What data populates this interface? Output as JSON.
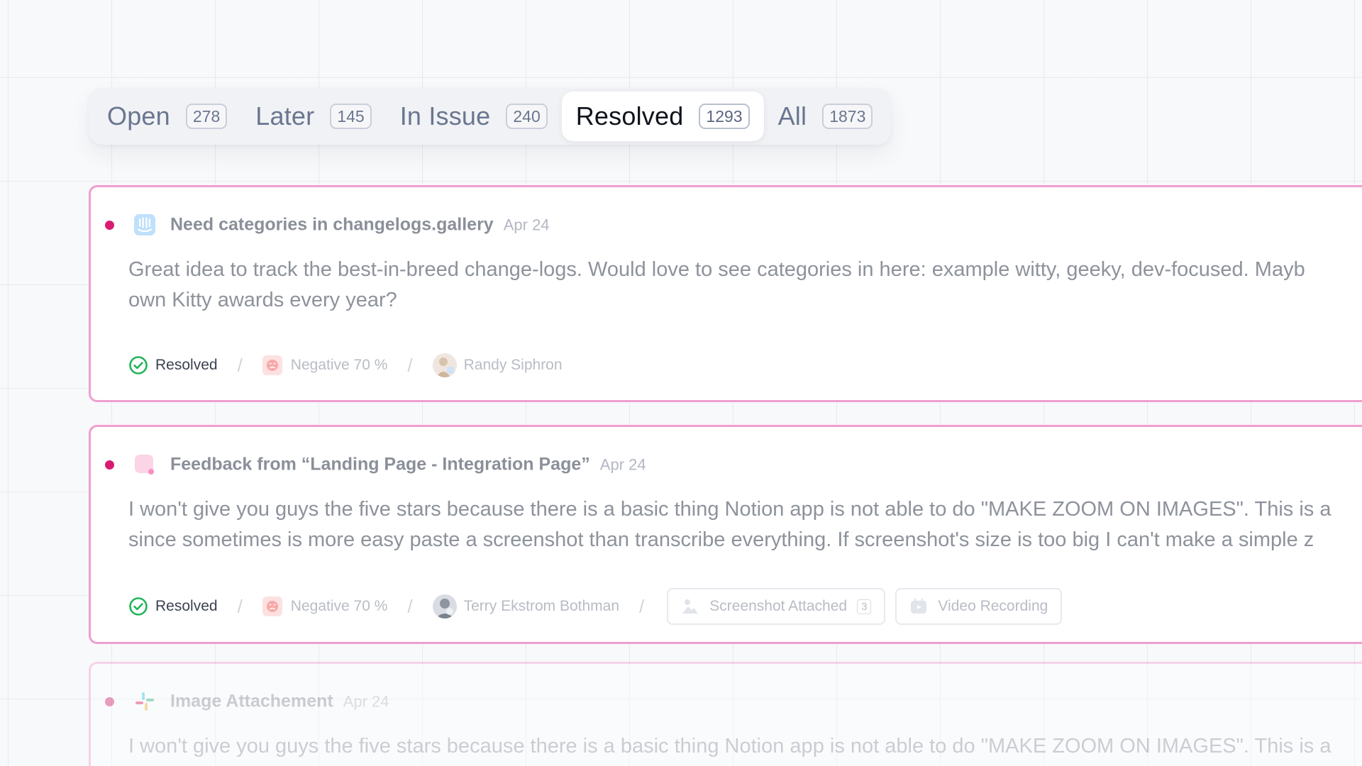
{
  "tabs": [
    {
      "label": "Open",
      "count": "278"
    },
    {
      "label": "Later",
      "count": "145"
    },
    {
      "label": "In Issue",
      "count": "240"
    },
    {
      "label": "Resolved",
      "count": "1293"
    },
    {
      "label": "All",
      "count": "1873"
    }
  ],
  "active_tab": "Resolved",
  "colors": {
    "accent_dot": "#d81b71",
    "card_border": "#ef9fd0",
    "resolved_green": "#22b45a"
  },
  "cards": [
    {
      "source_icon": "intercom-icon",
      "title": "Need categories in changelogs.gallery",
      "date": "Apr 24",
      "body_line1": "Great idea to track the best-in-breed change-logs. Would love to see categories in here: example witty, geeky, dev-focused. Mayb",
      "body_line2": "own Kitty awards every year?",
      "status": "Resolved",
      "sentiment": "Negative 70 %",
      "author": "Randy Siphron"
    },
    {
      "source_icon": "feedback-widget-icon",
      "title": "Feedback from “Landing Page - Integration Page”",
      "date": "Apr 24",
      "body_line1": "I won't give you guys the five stars because there is a basic thing Notion app is not able to do \"MAKE ZOOM ON IMAGES\". This is a",
      "body_line2": "since sometimes is more easy paste a screenshot than transcribe everything. If screenshot's size is too big I can't make a simple z",
      "status": "Resolved",
      "sentiment": "Negative 70 %",
      "author": "Terry Ekstrom Bothman",
      "attachments": [
        {
          "label": "Screenshot Attached",
          "count": "3",
          "icon": "image-icon"
        },
        {
          "label": "Video Recording",
          "icon": "video-icon"
        }
      ]
    },
    {
      "source_icon": "slack-icon",
      "title": "Image Attachement",
      "date": "Apr 24",
      "body_line1": "I won't give you guys the five stars because there is a basic thing Notion app is not able to do \"MAKE ZOOM ON IMAGES\". This is a"
    }
  ]
}
